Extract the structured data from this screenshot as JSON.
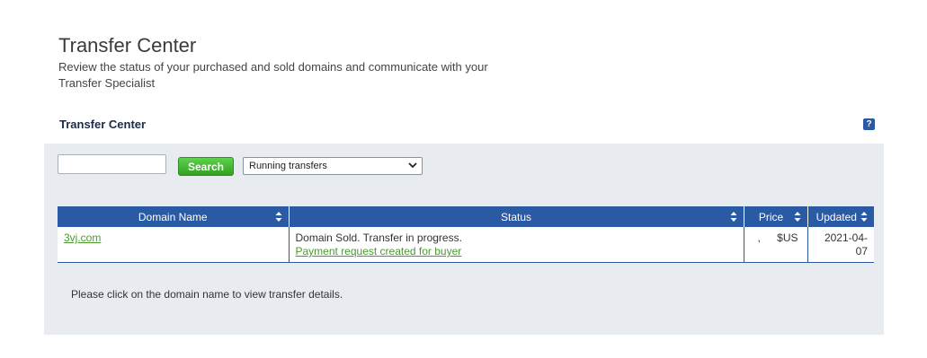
{
  "header": {
    "title": "Transfer Center",
    "subtitle": "Review the status of your purchased and sold domains and communicate with your Transfer Specialist"
  },
  "section": {
    "title": "Transfer Center",
    "help_label": "?"
  },
  "search": {
    "value": "",
    "button_label": "Search"
  },
  "filter": {
    "selected": "Running transfers"
  },
  "table": {
    "columns": [
      "Domain Name",
      "Status",
      "Price",
      "Updated"
    ],
    "rows": [
      {
        "domain": "3vj.com",
        "status": "Domain Sold. Transfer in progress.",
        "status_link": "Payment request created for buyer",
        "price_amount": ",",
        "price_currency": "$US",
        "updated": "2021-04-07"
      }
    ]
  },
  "hint": "Please click on the domain name to view transfer details.",
  "colors": {
    "header_blue": "#2a5aa3",
    "panel_bg": "#e8ecf1",
    "link_green": "#4a9a2e",
    "button_green": "#3cb22a"
  },
  "icons": [
    "help-icon",
    "sort-icon",
    "chevron-down-icon"
  ]
}
